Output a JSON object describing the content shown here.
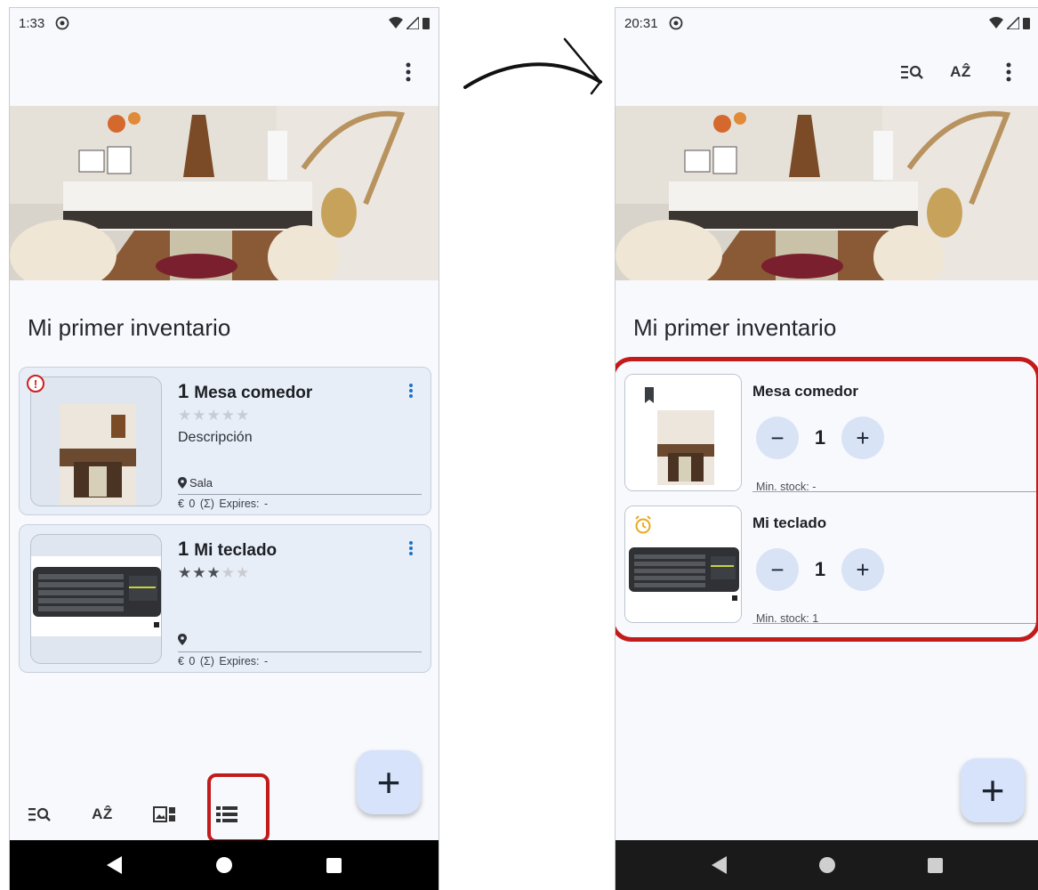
{
  "left": {
    "status": {
      "time": "1:33"
    },
    "inventory_title": "Mi primer inventario",
    "items": [
      {
        "qty": "1",
        "name": "Mesa comedor",
        "rating": 0,
        "description": "Descripción",
        "location": "Sala",
        "price_line": "€ 0  (Σ)  Expires: -",
        "alert": "!"
      },
      {
        "qty": "1",
        "name": "Mi teclado",
        "rating": 3,
        "description": "",
        "location": "",
        "price_line": "€ 0  (Σ)  Expires: -"
      }
    ],
    "fab_label": "+",
    "bottom_bar": [
      "filter-search",
      "sort-az",
      "gallery-view",
      "list-view"
    ],
    "bottom_labels": {
      "sort": "AẐ"
    }
  },
  "right": {
    "status": {
      "time": "20:31"
    },
    "appbar": {
      "sort": "AẐ"
    },
    "inventory_title": "Mi primer inventario",
    "items": [
      {
        "name": "Mesa comedor",
        "qty": "1",
        "min_stock": "Min. stock: -",
        "badge": "bookmark-icon"
      },
      {
        "name": "Mi teclado",
        "qty": "1",
        "min_stock": "Min. stock: 1",
        "badge": "alarm-icon"
      }
    ],
    "minus": "−",
    "plus": "+",
    "fab_label": "+"
  },
  "colors": {
    "accent_fab": "#d6e3fb",
    "highlight": "#c21b1b",
    "card_bg": "#e8eef7",
    "stepper": "#d9e3f6"
  }
}
